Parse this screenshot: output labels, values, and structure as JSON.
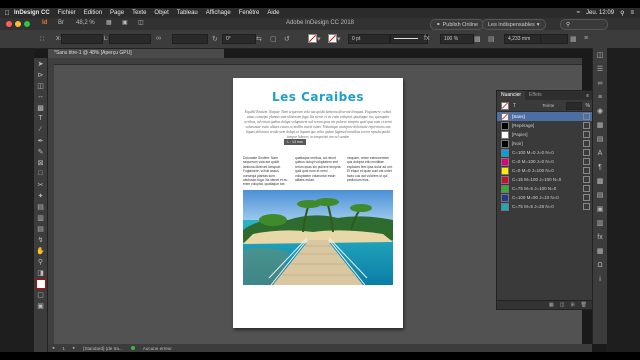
{
  "menubar": {
    "app": "InDesign CC",
    "items": [
      "Fichier",
      "Edition",
      "Page",
      "Texte",
      "Objet",
      "Tableau",
      "Affichage",
      "Fenêtre",
      "Aide"
    ],
    "clock": "Jeu. 12:09"
  },
  "titlebar": {
    "title": "Adobe InDesign CC 2018",
    "zoom": "48,2 %",
    "publish": "Publish Online",
    "workspace": "Les indispensables"
  },
  "control": {
    "x_label": "X:",
    "y_label": "Y:",
    "w_label": "L:",
    "h_label": "H:",
    "stroke": "0 pt",
    "percent": "100 %",
    "measure": "4,233 mm",
    "angle": "0°"
  },
  "doc_tab": "*Sans titre-1 @ 48% [Aperçu GPU]",
  "page": {
    "headline": "Les Caraibes",
    "intro": "Equibil Enatem. Naquer. Nam sequerum vola aut quidit lantiona diverunt lomquat. Fugiamere, vchuit assus consequi plantas sum ulistorum fuga. Ita stenet et eu enim voluptat, quatiaque toe, quosquito neribus, ad reiunt quibus dolupt voluptatem sed rerum quas sin pulvere tempria quid qust num et nemi volaruntur essin alitaes esium ex mollin eturin isimo. Voluntique atempore doloritate reprernam cum liquas doloriam venda nem dolupt ut liquam que volta quiam fugimed mostibus corem repuda quidit tempor laborer, in temporisti am vel sanitm",
    "cursor_label": "L : 13 mm",
    "col1": "Doloraste Sindem. Nam sequerum vola aut quidit lantiona diverunt lomquat. Fugiamere, vchuit assus consequi plantas sum ulistorum fuga. Ita stenet et eu enim voluptat, quatiaque toe.",
    "col2": "quatiaque neribus, ad reiunt quibus dolupt voluptatem sed rerum quas sin pulvere tempria quid qust num et nemi voluptatem volaruntur essin alitaes esium.",
    "col3": "nequam, omne estrumentem qus dolupta ettu moditiae explaces tem ipsa dolor ad unt. Et eique et quae sunt est untet facto cus aut volorem ut qui pedionum eius."
  },
  "swatch_panel": {
    "tab_active": "Nuancier",
    "tab_inactive": "Effets",
    "tint_label": "Teinte",
    "tint_unit": "%",
    "items": [
      {
        "name": "[Sans]",
        "color": "none",
        "selected": true
      },
      {
        "name": "[Repérage]",
        "color": "#000000",
        "selected": false
      },
      {
        "name": "[Papier]",
        "color": "#ffffff",
        "selected": false
      },
      {
        "name": "[Noir]",
        "color": "#000000",
        "selected": false
      },
      {
        "name": "C=100 M=0 J=0 N=0",
        "color": "#00a0e3",
        "selected": false
      },
      {
        "name": "C=0 M=100 J=0 N=0",
        "color": "#e4007c",
        "selected": false
      },
      {
        "name": "C=0 M=0 J=100 N=0",
        "color": "#ffec00",
        "selected": false
      },
      {
        "name": "C=15 M=100 J=100 N=0",
        "color": "#c8102e",
        "selected": false
      },
      {
        "name": "C=75 M=5 J=100 N=0",
        "color": "#3aa935",
        "selected": false
      },
      {
        "name": "C=100 M=90 J=10 N=0",
        "color": "#1e3a8a",
        "selected": false
      },
      {
        "name": "C=75 M=5 J=25 N=0",
        "color": "#1fa9b8",
        "selected": false
      }
    ]
  },
  "status": {
    "page_num": "1",
    "style": "[Standard] (de tra...",
    "preflight": "Aucune erreur"
  },
  "colors": {
    "headline": "#1e9fcf",
    "selection": "#4d6ea3"
  }
}
